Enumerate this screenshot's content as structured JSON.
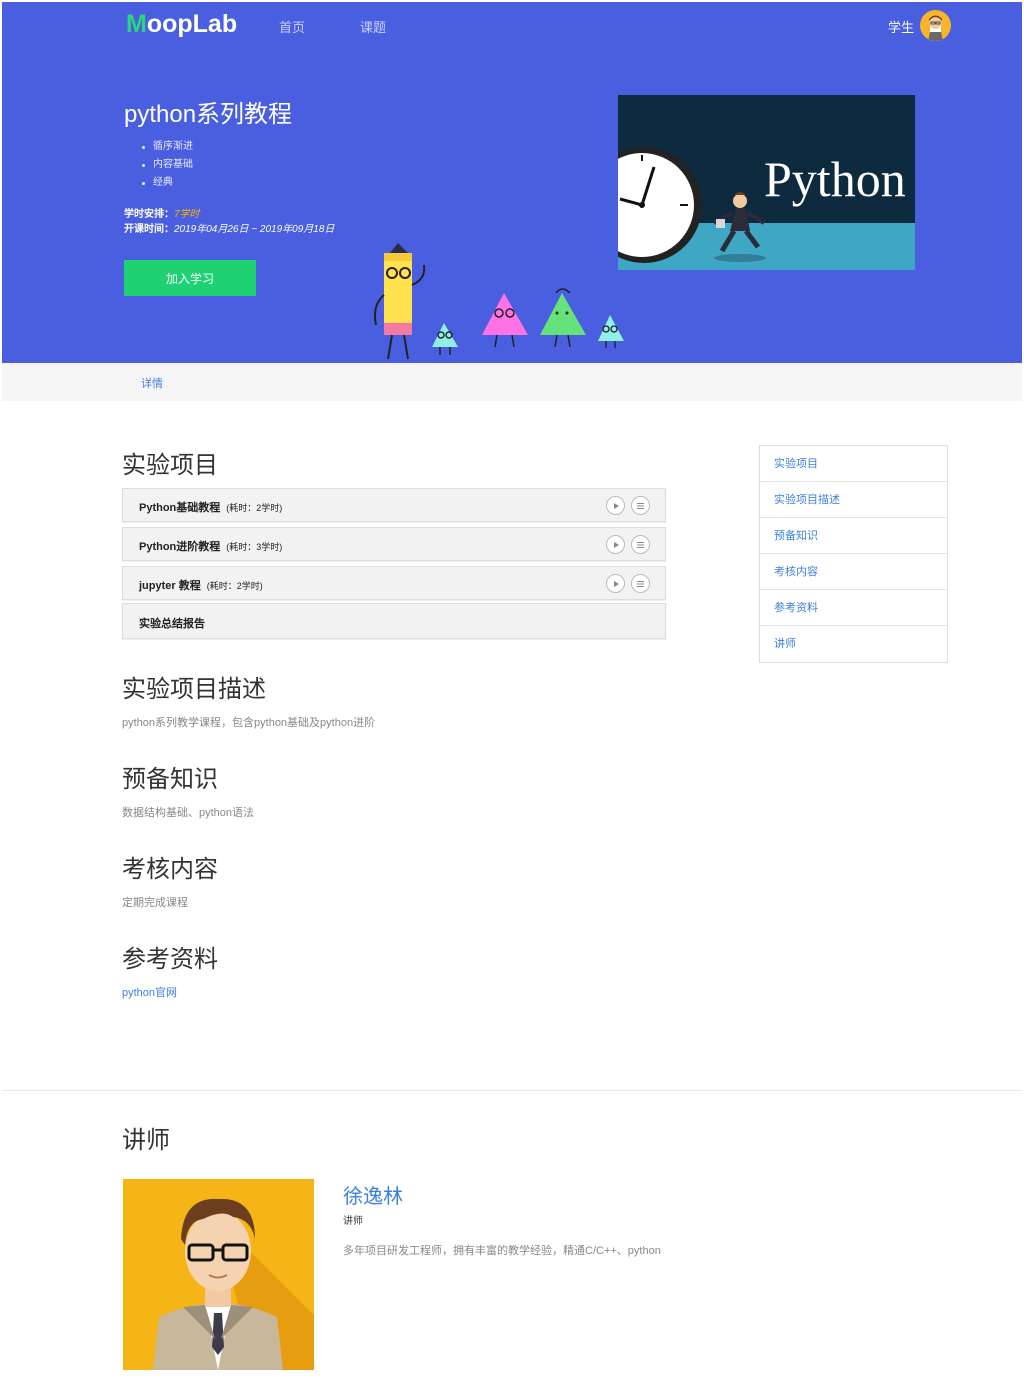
{
  "nav": {
    "logo_m": "M",
    "logo_rest": "oopLab",
    "links": [
      "首页",
      "课题"
    ],
    "user": "学生"
  },
  "hero": {
    "title": "python系列教程",
    "features": [
      "循序渐进",
      "内容基础",
      "经典"
    ],
    "hours_label": "学时安排：",
    "hours_value": "7学时",
    "dates_label": "开课时间：",
    "dates_value": "2019年04月26日 ~ 2019年09月18日",
    "join_label": "加入学习",
    "cover_text": "Python"
  },
  "tabs": {
    "detail": "详情"
  },
  "projects": {
    "heading": "实验项目",
    "items": [
      {
        "name": "Python基础教程",
        "duration": "(耗时：2学时)",
        "has_actions": true
      },
      {
        "name": "Python进阶教程",
        "duration": "(耗时：3学时)",
        "has_actions": true
      },
      {
        "name": "jupyter 教程",
        "duration": "(耗时：2学时)",
        "has_actions": true
      },
      {
        "name": "实验总结报告",
        "duration": "",
        "has_actions": false
      }
    ]
  },
  "description": {
    "heading": "实验项目描述",
    "text": "python系列教学课程，包含python基础及python进阶"
  },
  "prerequisites": {
    "heading": "预备知识",
    "text": "数据结构基础、python语法"
  },
  "assessment": {
    "heading": "考核内容",
    "text": "定期完成课程"
  },
  "references": {
    "heading": "参考资料",
    "link": "python官网"
  },
  "toc": [
    "实验项目",
    "实验项目描述",
    "预备知识",
    "考核内容",
    "参考资料",
    "讲师"
  ],
  "teacher": {
    "heading": "讲师",
    "name": "徐逸林",
    "role": "讲师",
    "bio": "多年项目研发工程师，拥有丰富的教学经验，精通C/C++、python"
  },
  "colors": {
    "primary": "#4a5fe0",
    "accent_green": "#1ed273",
    "link_blue": "#3d7fe0",
    "highlight": "#ffb400"
  },
  "icons": [
    "play-icon",
    "list-icon",
    "avatar",
    "pencil-mascot",
    "clock",
    "running-man"
  ]
}
